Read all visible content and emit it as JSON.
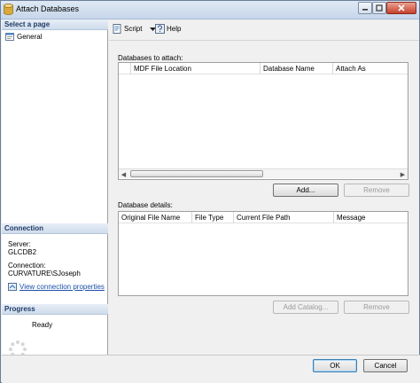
{
  "window": {
    "title": "Attach Databases"
  },
  "icons": {
    "app": "database-icon",
    "general": "page-icon",
    "script": "script-icon",
    "help": "help-icon",
    "link": "connection-icon",
    "progress": "spinner-icon"
  },
  "left_pane": {
    "select_page_header": "Select a page",
    "pages": [
      {
        "label": "General"
      }
    ],
    "connection_header": "Connection",
    "server_label": "Server:",
    "server_value": "GLCDB2",
    "connection_label": "Connection:",
    "connection_value": "CURVATURE\\SJoseph",
    "view_link": "View connection properties",
    "progress_header": "Progress",
    "progress_status": "Ready"
  },
  "toolbar": {
    "script_label": "Script",
    "help_label": "Help"
  },
  "attach_section": {
    "label": "Databases to attach:",
    "columns": [
      "MDF File Location",
      "Database Name",
      "Attach As"
    ],
    "rows": [],
    "add_button": "Add...",
    "remove_button": "Remove"
  },
  "details_section": {
    "label": "Database details:",
    "columns": [
      "Original File Name",
      "File Type",
      "Current File Path",
      "Message"
    ],
    "rows": [],
    "add_catalog_button": "Add Catalog...",
    "remove_button": "Remove"
  },
  "footer": {
    "ok_button": "OK",
    "cancel_button": "Cancel"
  }
}
